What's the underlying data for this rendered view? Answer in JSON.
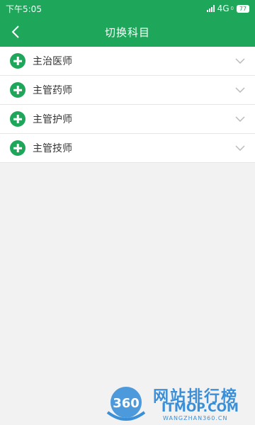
{
  "status_bar": {
    "time": "下午5:05",
    "network": "4G",
    "network_sub": "0",
    "battery": "77"
  },
  "header": {
    "title": "切换科目"
  },
  "subjects": [
    {
      "label": "主治医师"
    },
    {
      "label": "主管药师"
    },
    {
      "label": "主管护师"
    },
    {
      "label": "主管技师"
    }
  ],
  "watermark": {
    "logo_text": "360",
    "title": "网站排行榜",
    "domain": "ITMOP.COM",
    "sub": "WANGZHAN360.CN"
  },
  "colors": {
    "brand_green": "#1ea65a",
    "watermark_blue": "#3a8fd9"
  },
  "icons": {
    "back": "chevron-left-icon",
    "item": "plus-circle-icon",
    "expand": "chevron-down-icon"
  }
}
